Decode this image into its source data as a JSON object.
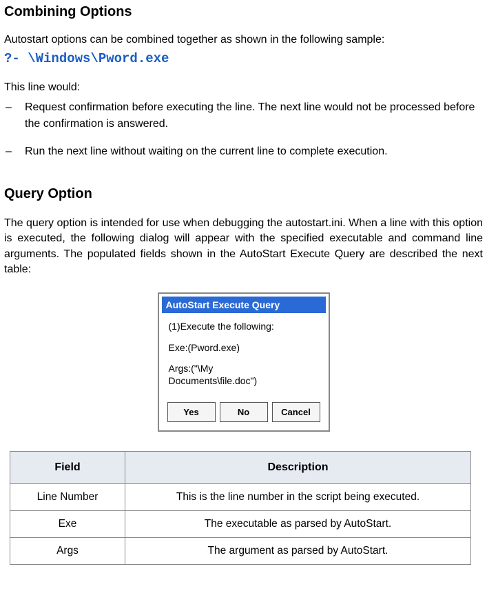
{
  "section1": {
    "heading": "Combining Options",
    "intro": "Autostart options can be combined together as shown in the following sample:",
    "code": "?- \\Windows\\Pword.exe",
    "lead": "This line would:",
    "bullets": [
      "Request confirmation before executing the line. The next line would not be processed before the confirmation is answered.",
      "Run the next line without waiting on the current line to complete execution."
    ]
  },
  "section2": {
    "heading": "Query Option",
    "para": "The query option is intended for use when debugging the autostart.ini. When a line with this option is executed, the following dialog will appear with the specified executable and command line arguments. The populated fields shown in the AutoStart Execute Query are described the next table:"
  },
  "dialog": {
    "title": "AutoStart Execute Query",
    "line1": "(1)Execute the following:",
    "line2": "Exe:(Pword.exe)",
    "line3a": "Args:(\"\\My",
    "line3b": "Documents\\file.doc\")",
    "buttons": {
      "yes": "Yes",
      "no": "No",
      "cancel": "Cancel"
    }
  },
  "table": {
    "headers": {
      "field": "Field",
      "desc": "Description"
    },
    "rows": [
      {
        "field": "Line Number",
        "desc": "This is the line number in the script being executed."
      },
      {
        "field": "Exe",
        "desc": "The executable as parsed by AutoStart."
      },
      {
        "field": "Args",
        "desc": "The argument as parsed by AutoStart."
      }
    ]
  }
}
